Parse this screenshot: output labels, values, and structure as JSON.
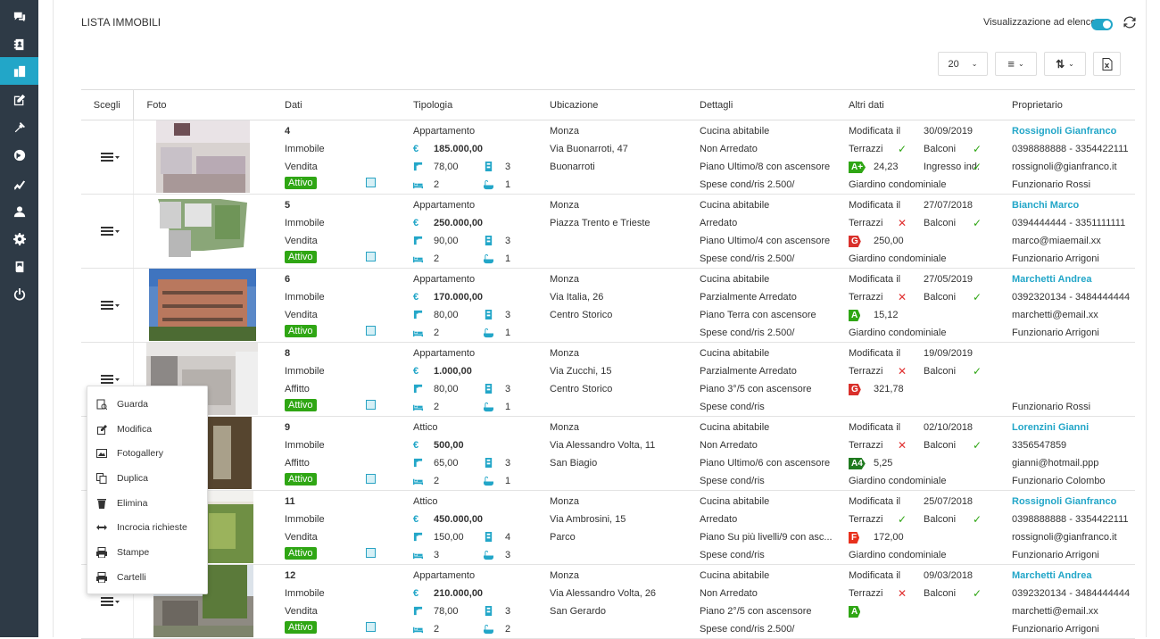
{
  "sidebar": {
    "items": [
      {
        "icon": "chat-icon"
      },
      {
        "icon": "contacts-icon"
      },
      {
        "icon": "buildings-icon"
      },
      {
        "icon": "edit-icon"
      },
      {
        "icon": "tools-icon"
      },
      {
        "icon": "globe-icon"
      },
      {
        "icon": "chart-icon"
      },
      {
        "icon": "user-icon"
      },
      {
        "icon": "gear-icon"
      },
      {
        "icon": "book-icon"
      },
      {
        "icon": "power-icon"
      }
    ],
    "active_index": 2
  },
  "header": {
    "title": "LISTA IMMOBILI",
    "view_label": "Visualizzazione ad elenco",
    "view_toggle_on": true
  },
  "controls": {
    "page_size": "20"
  },
  "table": {
    "columns": [
      "Scegli",
      "Foto",
      "Dati",
      "Tipologia",
      "Ubicazione",
      "Dettagli",
      "Altri dati",
      "Proprietario"
    ],
    "rows": [
      {
        "id": "4",
        "cat": "Immobile",
        "contract": "Vendita",
        "status": "Attivo",
        "type": "Appartamento",
        "price": "185.000,00",
        "sqm": "78,00",
        "rooms": "3",
        "beds": "2",
        "baths": "1",
        "city": "Monza",
        "address": "Via Buonarroti, 47",
        "zone": "Buonarroti",
        "d1": "Cucina abitabile",
        "d2": "Non Arredato",
        "d3": "Piano Ultimo/8 con ascensore",
        "d4": "Spese cond/ris 2.500/",
        "mod_label": "Modificata il",
        "mod_date": "30/09/2019",
        "terrazzi": "Terrazzi",
        "terrazzi_ok": true,
        "balconi": "Balconi",
        "balconi_ok": true,
        "energy": "A+",
        "energy_color": "#2fa614",
        "energy_val": "24,23",
        "extra": "Ingresso ind.",
        "extra_ok": true,
        "garden": "Giardino condominiale",
        "owner": "Rossignoli Gianfranco",
        "phone": "0398888888 - 3354422111",
        "email": "rossignoli@gianfranco.it",
        "agent": "Funzionario Rossi"
      },
      {
        "id": "5",
        "cat": "Immobile",
        "contract": "Vendita",
        "status": "Attivo",
        "type": "Appartamento",
        "price": "250.000,00",
        "sqm": "90,00",
        "rooms": "3",
        "beds": "2",
        "baths": "1",
        "city": "Monza",
        "address": "Piazza Trento e Trieste",
        "zone": "",
        "d1": "Cucina abitabile",
        "d2": "Arredato",
        "d3": "Piano Ultimo/4 con ascensore",
        "d4": "Spese cond/ris 2.500/",
        "mod_label": "Modificata il",
        "mod_date": "27/07/2018",
        "terrazzi": "Terrazzi",
        "terrazzi_ok": false,
        "balconi": "Balconi",
        "balconi_ok": true,
        "energy": "G",
        "energy_color": "#d9302b",
        "energy_val": "250,00",
        "extra": "",
        "extra_ok": null,
        "garden": "Giardino condominiale",
        "owner": "Bianchi Marco",
        "phone": "0394444444 - 3351111111",
        "email": "marco@miaemail.xx",
        "agent": "Funzionario Arrigoni"
      },
      {
        "id": "6",
        "cat": "Immobile",
        "contract": "Vendita",
        "status": "Attivo",
        "type": "Appartamento",
        "price": "170.000,00",
        "sqm": "80,00",
        "rooms": "3",
        "beds": "2",
        "baths": "1",
        "city": "Monza",
        "address": "Via Italia, 26",
        "zone": "Centro Storico",
        "d1": "Cucina abitabile",
        "d2": "Parzialmente Arredato",
        "d3": "Piano Terra con ascensore",
        "d4": "Spese cond/ris 2.500/",
        "mod_label": "Modificata il",
        "mod_date": "27/05/2019",
        "terrazzi": "Terrazzi",
        "terrazzi_ok": false,
        "balconi": "Balconi",
        "balconi_ok": true,
        "energy": "A",
        "energy_color": "#2fa614",
        "energy_val": "15,12",
        "extra": "",
        "extra_ok": null,
        "garden": "Giardino condominiale",
        "owner": "Marchetti Andrea",
        "phone": "0392320134 - 3484444444",
        "email": "marchetti@email.xx",
        "agent": "Funzionario Arrigoni"
      },
      {
        "id": "8",
        "cat": "Immobile",
        "contract": "Affitto",
        "status": "Attivo",
        "type": "Appartamento",
        "price": "1.000,00",
        "sqm": "80,00",
        "rooms": "3",
        "beds": "2",
        "baths": "1",
        "city": "Monza",
        "address": "Via Zucchi, 15",
        "zone": "Centro Storico",
        "d1": "Cucina abitabile",
        "d2": "Parzialmente Arredato",
        "d3": "Piano 3°/5 con ascensore",
        "d4": "Spese cond/ris",
        "mod_label": "Modificata il",
        "mod_date": "19/09/2019",
        "terrazzi": "Terrazzi",
        "terrazzi_ok": false,
        "balconi": "Balconi",
        "balconi_ok": true,
        "energy": "G",
        "energy_color": "#d9302b",
        "energy_val": "321,78",
        "extra": "",
        "extra_ok": null,
        "garden": "",
        "owner": "",
        "phone": "",
        "email": "",
        "agent": "Funzionario Rossi"
      },
      {
        "id": "9",
        "cat": "Immobile",
        "contract": "Affitto",
        "status": "Attivo",
        "type": "Attico",
        "price": "500,00",
        "sqm": "65,00",
        "rooms": "3",
        "beds": "2",
        "baths": "1",
        "city": "Monza",
        "address": "Via Alessandro Volta, 11",
        "zone": "San Biagio",
        "d1": "Cucina abitabile",
        "d2": "Non Arredato",
        "d3": "Piano Ultimo/6 con ascensore",
        "d4": "Spese cond/ris",
        "mod_label": "Modificata il",
        "mod_date": "02/10/2018",
        "terrazzi": "Terrazzi",
        "terrazzi_ok": false,
        "balconi": "Balconi",
        "balconi_ok": true,
        "energy": "A4",
        "energy_color": "#1f7a1f",
        "energy_val": "5,25",
        "extra": "",
        "extra_ok": null,
        "garden": "Giardino condominiale",
        "owner": "Lorenzini Gianni",
        "phone": "3356547859",
        "email": "gianni@hotmail.ppp",
        "agent": "Funzionario Colombo"
      },
      {
        "id": "11",
        "cat": "Immobile",
        "contract": "Vendita",
        "status": "Attivo",
        "type": "Attico",
        "price": "450.000,00",
        "sqm": "150,00",
        "rooms": "4",
        "beds": "3",
        "baths": "3",
        "city": "Monza",
        "address": "Via Ambrosini, 15",
        "zone": "Parco",
        "d1": "Cucina abitabile",
        "d2": "Arredato",
        "d3": "Piano Su più livelli/9 con asc...",
        "d4": "Spese cond/ris",
        "mod_label": "Modificata il",
        "mod_date": "25/07/2018",
        "terrazzi": "Terrazzi",
        "terrazzi_ok": true,
        "balconi": "Balconi",
        "balconi_ok": true,
        "energy": "F",
        "energy_color": "#e8301c",
        "energy_val": "172,00",
        "extra": "",
        "extra_ok": null,
        "garden": "Giardino condominiale",
        "owner": "Rossignoli Gianfranco",
        "phone": "0398888888 - 3354422111",
        "email": "rossignoli@gianfranco.it",
        "agent": "Funzionario Arrigoni"
      },
      {
        "id": "12",
        "cat": "Immobile",
        "contract": "Vendita",
        "status": "Attivo",
        "type": "Appartamento",
        "price": "210.000,00",
        "sqm": "78,00",
        "rooms": "3",
        "beds": "2",
        "baths": "2",
        "city": "Monza",
        "address": "Via Alessandro Volta, 26",
        "zone": "San Gerardo",
        "d1": "Cucina abitabile",
        "d2": "Non Arredato",
        "d3": "Piano 2°/5 con ascensore",
        "d4": "Spese cond/ris 2.500/",
        "mod_label": "Modificata il",
        "mod_date": "09/03/2018",
        "terrazzi": "Terrazzi",
        "terrazzi_ok": false,
        "balconi": "Balconi",
        "balconi_ok": true,
        "energy": "A",
        "energy_color": "#2fa614",
        "energy_val": "",
        "extra": "",
        "extra_ok": null,
        "garden": "",
        "owner": "Marchetti Andrea",
        "phone": "0392320134 - 3484444444",
        "email": "marchetti@email.xx",
        "agent": "Funzionario Arrigoni"
      }
    ]
  },
  "context_menu": {
    "items": [
      {
        "label": "Guarda",
        "icon": "view-icon"
      },
      {
        "label": "Modifica",
        "icon": "edit-icon"
      },
      {
        "label": "Fotogallery",
        "icon": "image-icon"
      },
      {
        "label": "Duplica",
        "icon": "copy-icon"
      },
      {
        "label": "Elimina",
        "icon": "trash-icon"
      },
      {
        "label": "Incrocia richieste",
        "icon": "arrows-icon"
      },
      {
        "label": "Stampe",
        "icon": "print-icon"
      },
      {
        "label": "Cartelli",
        "icon": "sign-icon"
      }
    ]
  },
  "colors": {
    "sidebar": "#2e3a46",
    "accent": "#22a6c8",
    "status_green": "#2fa614",
    "cross_red": "#e03030"
  }
}
